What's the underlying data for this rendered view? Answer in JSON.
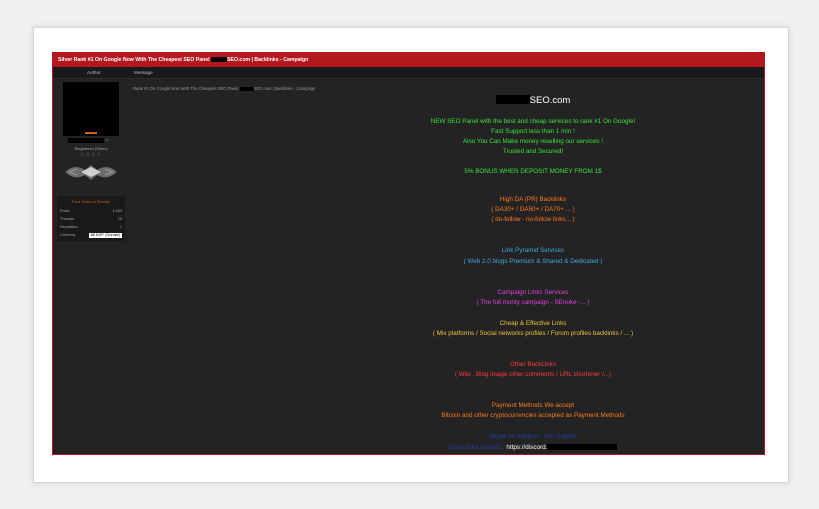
{
  "thread": {
    "title": "Silver Rank #1 On Google Now With The Cheapest SEO Panel",
    "title_suffix": "SEO.com | Backlinks - Campaign",
    "col_author": "Author",
    "col_message": "Message",
    "breadcrumb_pre": "Rank #1 On Google Now With The Cheapest SEO Panel",
    "breadcrumb_post": "SEO.com | Backlinks - Campaign"
  },
  "user": {
    "close_mark": "x",
    "group": "Registered (Silver)",
    "stars": "☆☆☆☆",
    "service": "Four Years of Service",
    "stats": [
      {
        "label": "Posts",
        "value": "1,353"
      },
      {
        "label": "Threads",
        "value": "29"
      },
      {
        "label": "Reputation",
        "value": "1"
      },
      {
        "label": "Currency",
        "value": "88 NSP. (Donate)"
      }
    ]
  },
  "post": {
    "site_name": "SEO.com",
    "lines": [
      {
        "text": "NEW SEO Panel with the best and cheap services to rank #1 On Google!",
        "color": "#39e639"
      },
      {
        "text": "Fast Support less than 1 min !",
        "color": "#39e639"
      },
      {
        "text": "Also You Can Make money reselling our services !",
        "color": "#39e639"
      },
      {
        "text": "Trusted and Secured!",
        "color": "#39e639"
      },
      {
        "text": "5% BONUS WHEN DEPOSIT MONEY FROM 1$",
        "color": "#39e639"
      },
      {
        "text": "High DA (PR) Backlinks",
        "color": "#ff7a1a"
      },
      {
        "text": "( DA30+ / DA50+ / DA70+ ... )",
        "color": "#ff7a1a"
      },
      {
        "text": "( do-follow - no-follow links... )",
        "color": "#ff7a1a"
      },
      {
        "text": "Link Pyramid Services",
        "color": "#3fa9e0"
      },
      {
        "text": "( Web 2.0 blogs Premium & Shared & Dedicated )",
        "color": "#3fa9e0"
      },
      {
        "text": "Campaign Links Services",
        "color": "#e040e0"
      },
      {
        "text": "( The full monty campaign - SEnuke -... )",
        "color": "#e040e0"
      },
      {
        "text": "Cheap & Effective Links",
        "color": "#f0c43a"
      },
      {
        "text": "( Mix platforms / Social networks profiles / Forum profiles backlinks / ... )",
        "color": "#f0c43a"
      },
      {
        "text": "Other BackLinks",
        "color": "#ff3a3a"
      },
      {
        "text": "( Wiki , Blog image other comments / URL shortener /...)",
        "color": "#ff3a3a"
      },
      {
        "text": "Payment Methods We accept",
        "color": "#ff7a1a"
      },
      {
        "text": "Bitcoin and other cryptocurrencies accepted as Payment Methods",
        "color": "#ff7a1a"
      },
      {
        "text": "Skype for support : 24h support",
        "color": "#1d3fa6"
      }
    ],
    "last_link": "https://discord.",
    "last_link_prefix": "Discord for contact :"
  }
}
